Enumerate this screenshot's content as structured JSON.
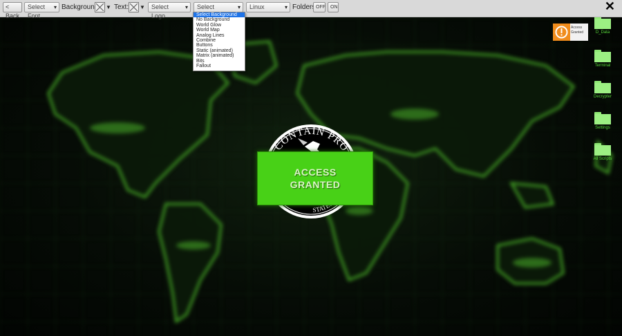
{
  "toolbar": {
    "back_label": "< Back",
    "font_select": "Select Font",
    "background_label": "Background:",
    "text_label": "Text:",
    "logo_select": "Select Logo",
    "background_select": "Select Background",
    "os_select": "Linux",
    "folders_label": "Folders:",
    "folders_off": "OFF",
    "folders_on": "ON",
    "close": "✕"
  },
  "dropdown": {
    "items": [
      "Select Background",
      "No Background",
      "World Glow",
      "World Map",
      "Analog Lines",
      "Combine",
      "Buttons",
      "Static (animated)",
      "Matrix (animated)",
      "Bits",
      "Fallout"
    ],
    "selected": "Select Background"
  },
  "seal": {
    "text_top": "WE CONTAIN PRO",
    "text_bottom": "STATES OF A"
  },
  "access": {
    "line1": "ACCESS",
    "line2": "GRANTED"
  },
  "warning": {
    "card_line1": "Access",
    "card_line2": "Granted"
  },
  "folders": [
    {
      "label": "D_Data"
    },
    {
      "label": "Terminal"
    },
    {
      "label": "Decrypter"
    },
    {
      "label": "Settings"
    },
    {
      "label": "All Scripts"
    }
  ],
  "colors": {
    "toolbar_bg": "#d9d9d9",
    "access_green": "#48d117",
    "folder_green": "#9cf083",
    "warn_orange": "#f08c1c",
    "map_glow": "#3a8a1f"
  }
}
